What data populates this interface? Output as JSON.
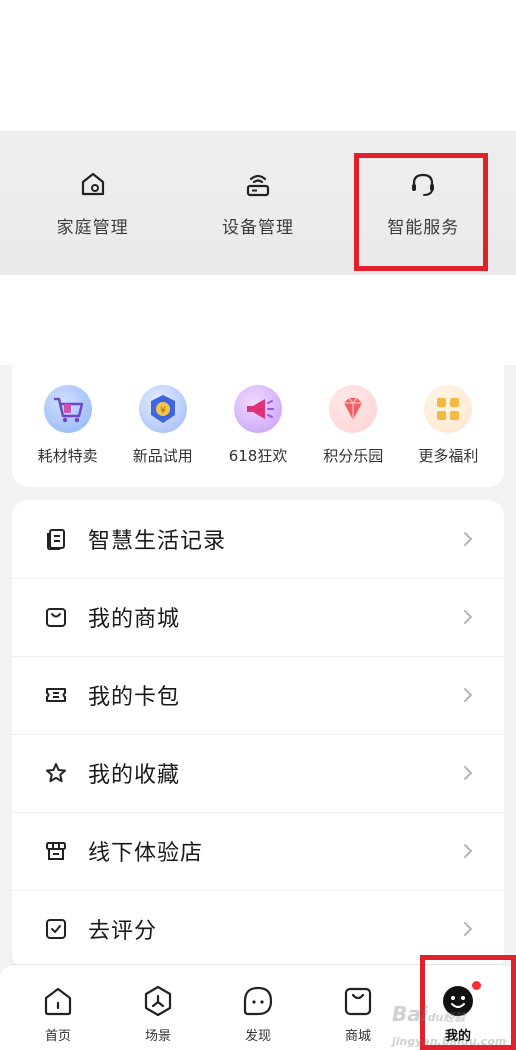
{
  "quick_actions": [
    {
      "label": "家庭管理",
      "icon": "home-settings-icon"
    },
    {
      "label": "设备管理",
      "icon": "router-icon"
    },
    {
      "label": "智能服务",
      "icon": "headset-icon"
    }
  ],
  "perks": [
    {
      "label": "耗材特卖",
      "icon": "cart-icon"
    },
    {
      "label": "新品试用",
      "icon": "trial-badge-icon"
    },
    {
      "label": "618狂欢",
      "icon": "megaphone-icon"
    },
    {
      "label": "积分乐园",
      "icon": "diamond-icon"
    },
    {
      "label": "更多福利",
      "icon": "grid-icon"
    }
  ],
  "menu": [
    {
      "label": "智慧生活记录",
      "icon": "records-icon"
    },
    {
      "label": "我的商城",
      "icon": "shopping-bag-icon"
    },
    {
      "label": "我的卡包",
      "icon": "ticket-icon"
    },
    {
      "label": "我的收藏",
      "icon": "star-icon"
    },
    {
      "label": "线下体验店",
      "icon": "store-icon"
    },
    {
      "label": "去评分",
      "icon": "check-box-icon"
    }
  ],
  "tabs": [
    {
      "label": "首页",
      "icon": "home-icon",
      "active": false
    },
    {
      "label": "场景",
      "icon": "scene-icon",
      "active": false
    },
    {
      "label": "发现",
      "icon": "discover-icon",
      "active": false
    },
    {
      "label": "商城",
      "icon": "mall-icon",
      "active": false
    },
    {
      "label": "我的",
      "icon": "profile-icon",
      "active": true,
      "has_badge": true
    }
  ],
  "watermark": {
    "brand": "Bai",
    "paw": "du",
    "suffix": "经验",
    "domain": "jingyan.baidu.com"
  },
  "colors": {
    "highlight": "#e0202b",
    "badge": "#ff2d2d",
    "background": "#f2f2f2"
  }
}
